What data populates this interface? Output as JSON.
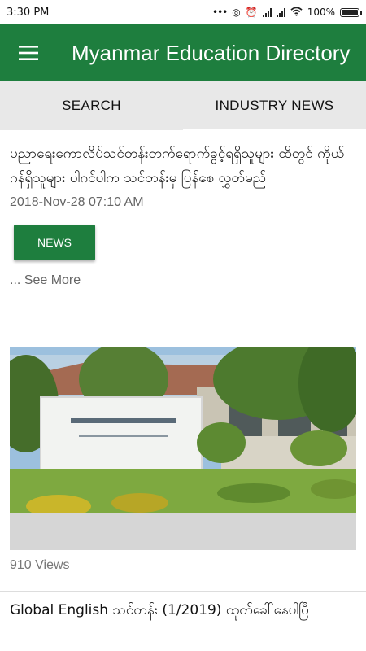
{
  "status": {
    "time": "3:30 PM",
    "battery": "100%"
  },
  "app": {
    "title": "Myanmar Education Directory",
    "accent": "#1e7e3e"
  },
  "tabs": [
    {
      "label": "SEARCH"
    },
    {
      "label": "INDUSTRY NEWS"
    }
  ],
  "article": {
    "headline": "ပညာရေးကောလိပ်သင်တန်းတက်ရောက်ခွင့်ရရှိသူများ ထိတွင် ကိုယ်ဂန်ရှိသူများ ပါဂင်ပါက သင်တန်းမှ ပြန်စေ လွှတ်မည်",
    "date": "2018-Nov-28 07:10 AM",
    "category_button": "NEWS",
    "see_more": "... See More"
  },
  "post": {
    "views": "910  Views"
  },
  "next_article": {
    "headline": "Global English သင်တန်း (1/2019) ထုတ်ခေါ်နေပါပြီ"
  }
}
